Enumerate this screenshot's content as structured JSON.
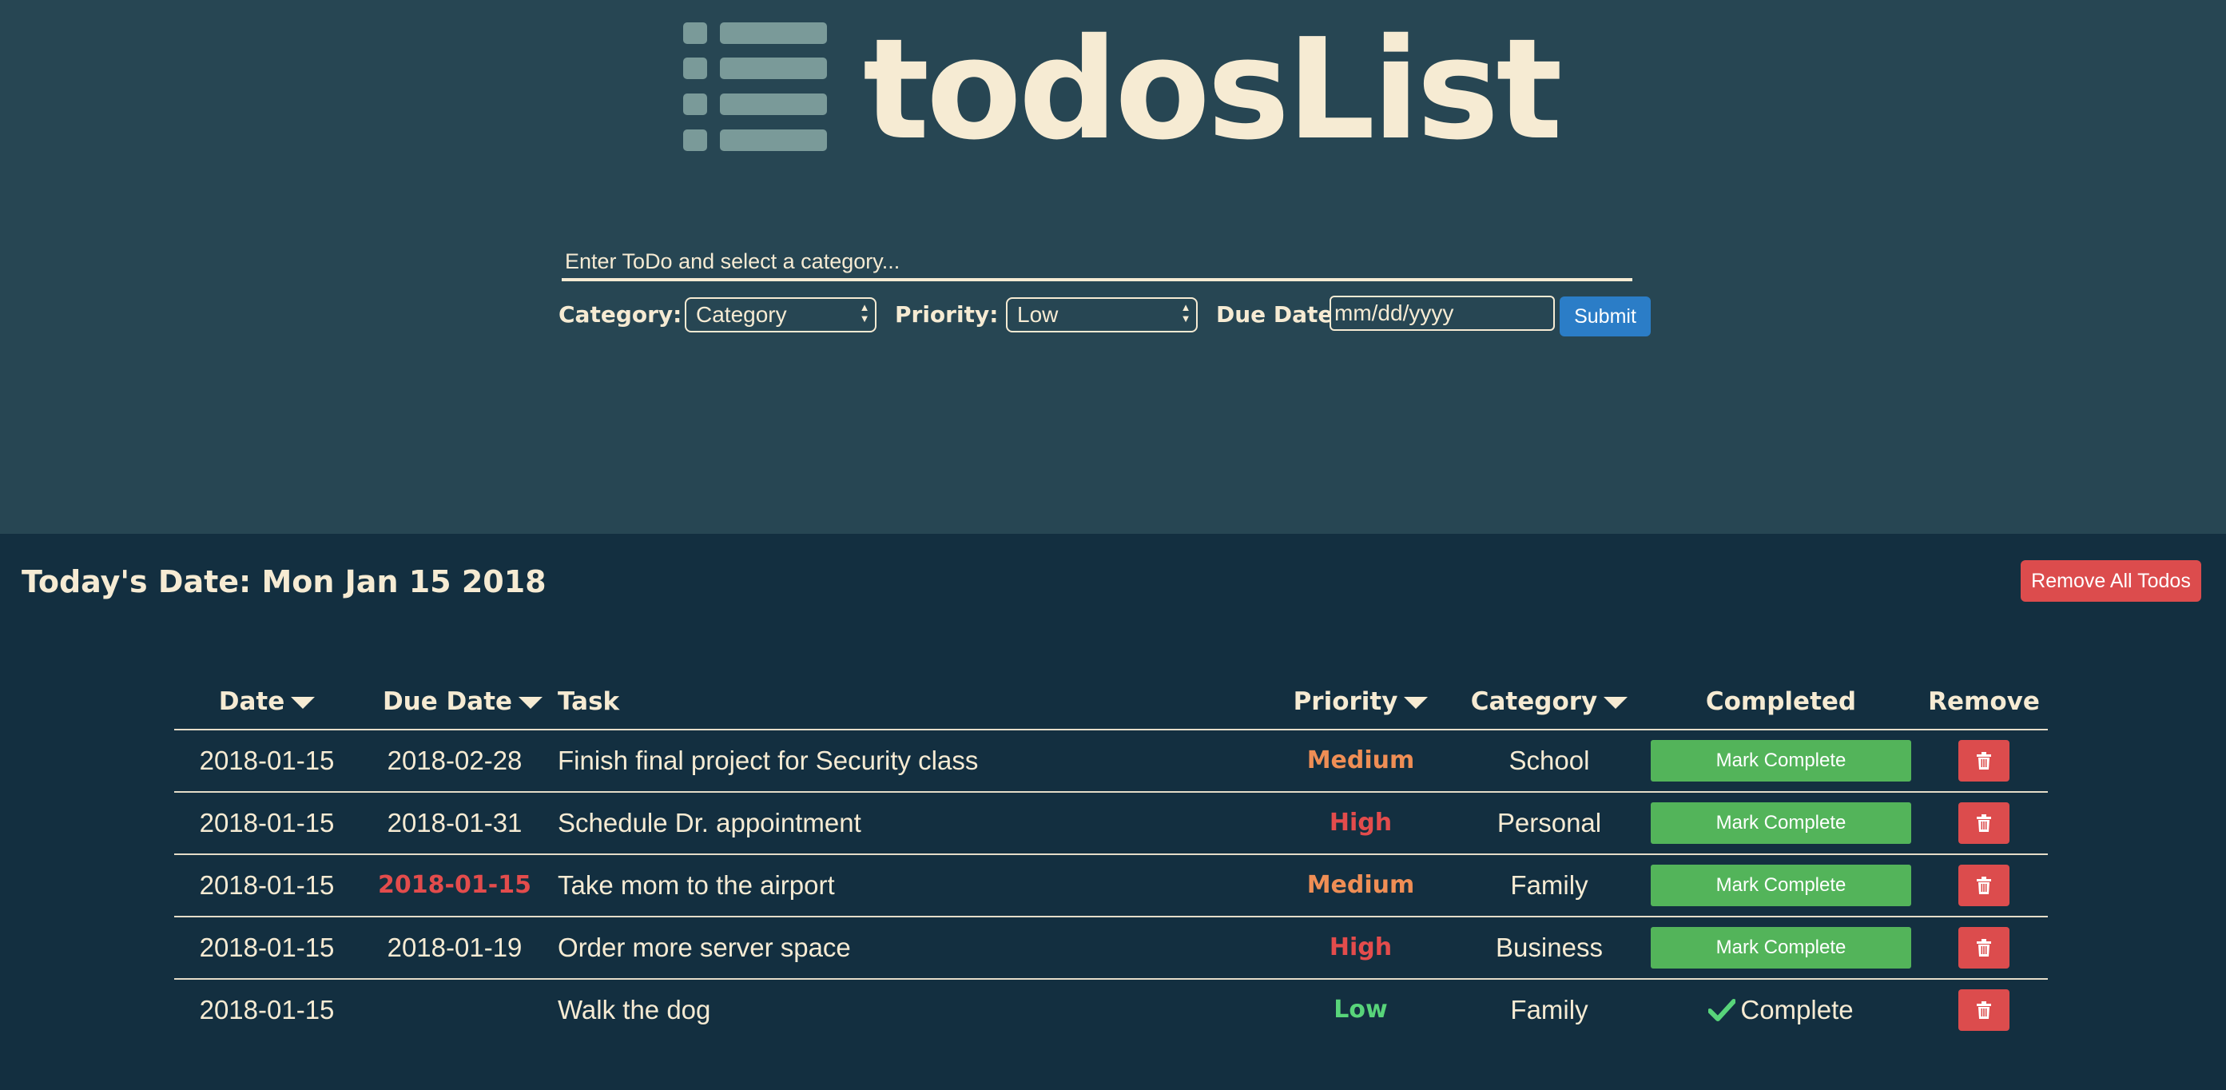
{
  "app": {
    "title": "todosList"
  },
  "form": {
    "todo_placeholder": "Enter ToDo and select a category...",
    "category_label": "Category:",
    "category_value": "Category",
    "priority_label": "Priority:",
    "priority_value": "Low",
    "due_date_label": "Due Date:",
    "due_date_placeholder": "mm/dd/yyyy",
    "submit_label": "Submit"
  },
  "main": {
    "today_label": "Today's Date: Mon Jan 15 2018",
    "remove_all_label": "Remove All Todos"
  },
  "table": {
    "headers": {
      "date": "Date",
      "due_date": "Due Date",
      "task": "Task",
      "priority": "Priority",
      "category": "Category",
      "completed": "Completed",
      "remove": "Remove"
    },
    "mark_complete_label": "Mark Complete",
    "complete_label": "Complete",
    "rows": [
      {
        "date": "2018-01-15",
        "due_date": "2018-02-28",
        "task": "Finish final project for Security class",
        "priority": "Medium",
        "category": "School",
        "completed": false,
        "overdue": false
      },
      {
        "date": "2018-01-15",
        "due_date": "2018-01-31",
        "task": "Schedule Dr. appointment",
        "priority": "High",
        "category": "Personal",
        "completed": false,
        "overdue": false
      },
      {
        "date": "2018-01-15",
        "due_date": "2018-01-15",
        "task": "Take mom to the airport",
        "priority": "Medium",
        "category": "Family",
        "completed": false,
        "overdue": true
      },
      {
        "date": "2018-01-15",
        "due_date": "2018-01-19",
        "task": "Order more server space",
        "priority": "High",
        "category": "Business",
        "completed": false,
        "overdue": false
      },
      {
        "date": "2018-01-15",
        "due_date": "",
        "task": "Walk the dog",
        "priority": "Low",
        "category": "Family",
        "completed": true,
        "overdue": false
      }
    ]
  },
  "colors": {
    "header_bg": "#274653",
    "body_bg": "#132f40",
    "text": "#f6ebd3",
    "medium": "#ef8e55",
    "high": "#e34c4c",
    "low": "#58d47a",
    "overdue": "#e34c4c",
    "mark_complete": "#53b45a",
    "danger": "#dc4c4d",
    "submit": "#2b7dc7"
  },
  "icons": {
    "logo": "list-icon",
    "sort": "caret-down-icon",
    "remove": "trash-icon",
    "done": "check-icon"
  }
}
